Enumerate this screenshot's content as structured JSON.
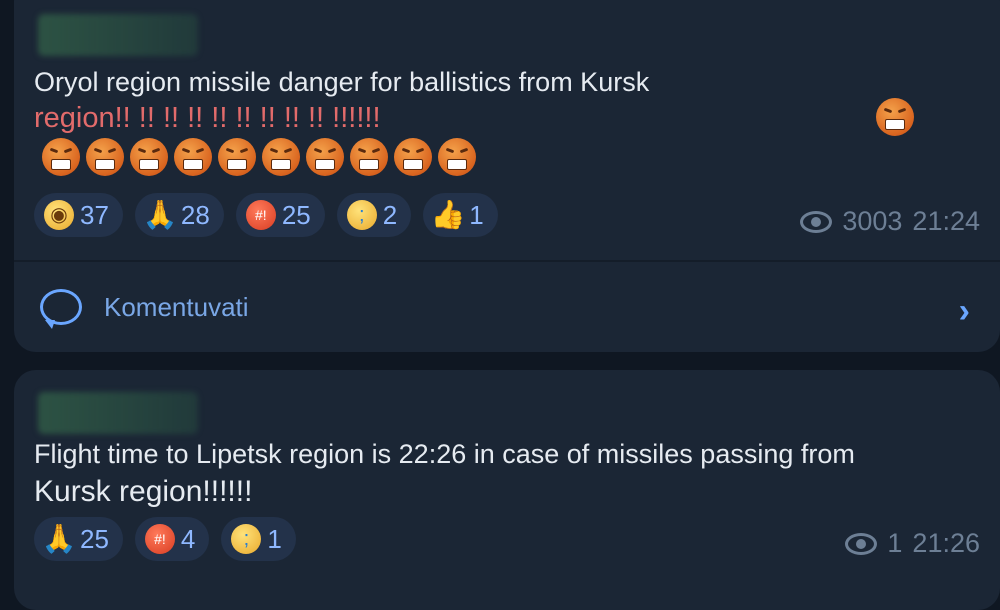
{
  "messages": [
    {
      "text_line1": "Oryol region missile danger for ballistics from Kursk",
      "text_line2": "region!! !! !! !! !! !! !! !! !! !!!!!!",
      "trailing_emoji": "angry-face-with-symbols",
      "emoji_row_count": 10,
      "emoji_row_name": "angry-face-with-symbols",
      "reactions": [
        {
          "icon": "face-screaming-in-fear",
          "count": "37"
        },
        {
          "icon": "folded-hands",
          "count": "28"
        },
        {
          "icon": "angry-face-with-symbols",
          "count": "25"
        },
        {
          "icon": "crying-face",
          "count": "2"
        },
        {
          "icon": "thumbs-up",
          "count": "1"
        }
      ],
      "views": "3003",
      "time": "21:24",
      "comment_label": "Komentuvati"
    },
    {
      "text_line1": "Flight time to Lipetsk region is 22:26 in case of missiles passing from",
      "text_line2": "Kursk region!!!!!!",
      "reactions": [
        {
          "icon": "folded-hands",
          "count": "25"
        },
        {
          "icon": "angry-face-with-symbols",
          "count": "4"
        },
        {
          "icon": "crying-face",
          "count": "1"
        }
      ],
      "views": "1",
      "time": "21:26"
    }
  ],
  "colors": {
    "background": "#0f1722",
    "bubble": "#1b2635",
    "reaction_pill": "#23324a",
    "link": "#6aa6ff",
    "alert_text": "#e26b6b",
    "meta_text": "#6d7f95"
  }
}
